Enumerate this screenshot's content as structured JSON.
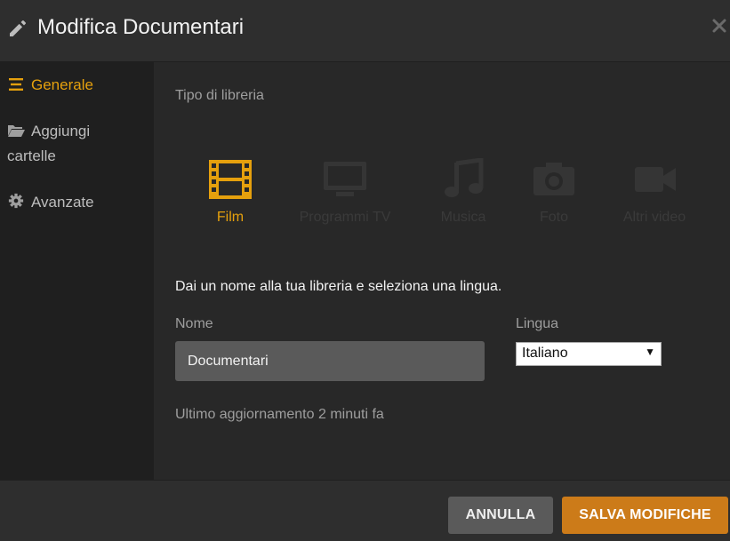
{
  "header": {
    "title": "Modifica Documentari",
    "edit_icon": "pencil-icon",
    "close_icon": "close-icon"
  },
  "sidebar": {
    "items": [
      {
        "label": "Generale",
        "icon": "list-icon",
        "active": true
      },
      {
        "label_line1": "Aggiungi",
        "label_line2": "cartelle",
        "icon": "folder-open-icon",
        "active": false
      },
      {
        "label": "Avanzate",
        "icon": "gear-icon",
        "active": false
      }
    ]
  },
  "main": {
    "section_label": "Tipo di libreria",
    "library_types": [
      {
        "label": "Film",
        "icon": "film-icon",
        "selected": true
      },
      {
        "label": "Programmi TV",
        "icon": "tv-icon",
        "selected": false
      },
      {
        "label": "Musica",
        "icon": "music-icon",
        "selected": false
      },
      {
        "label": "Foto",
        "icon": "camera-icon",
        "selected": false
      },
      {
        "label": "Altri video",
        "icon": "video-camera-icon",
        "selected": false
      }
    ],
    "description": "Dai un nome alla tua libreria e seleziona una lingua.",
    "name_label": "Nome",
    "name_value": "Documentari",
    "language_label": "Lingua",
    "language_value": "Italiano",
    "updated_text": "Ultimo aggiornamento 2 minuti fa"
  },
  "footer": {
    "cancel_label": "ANNULLA",
    "save_label": "SALVA MODIFICHE"
  },
  "colors": {
    "accent": "#e5a00d",
    "save_button": "#cc7b19",
    "cancel_button": "#5a5a5a",
    "sidebar_bg": "#1f1f1f",
    "main_bg": "#282828"
  }
}
